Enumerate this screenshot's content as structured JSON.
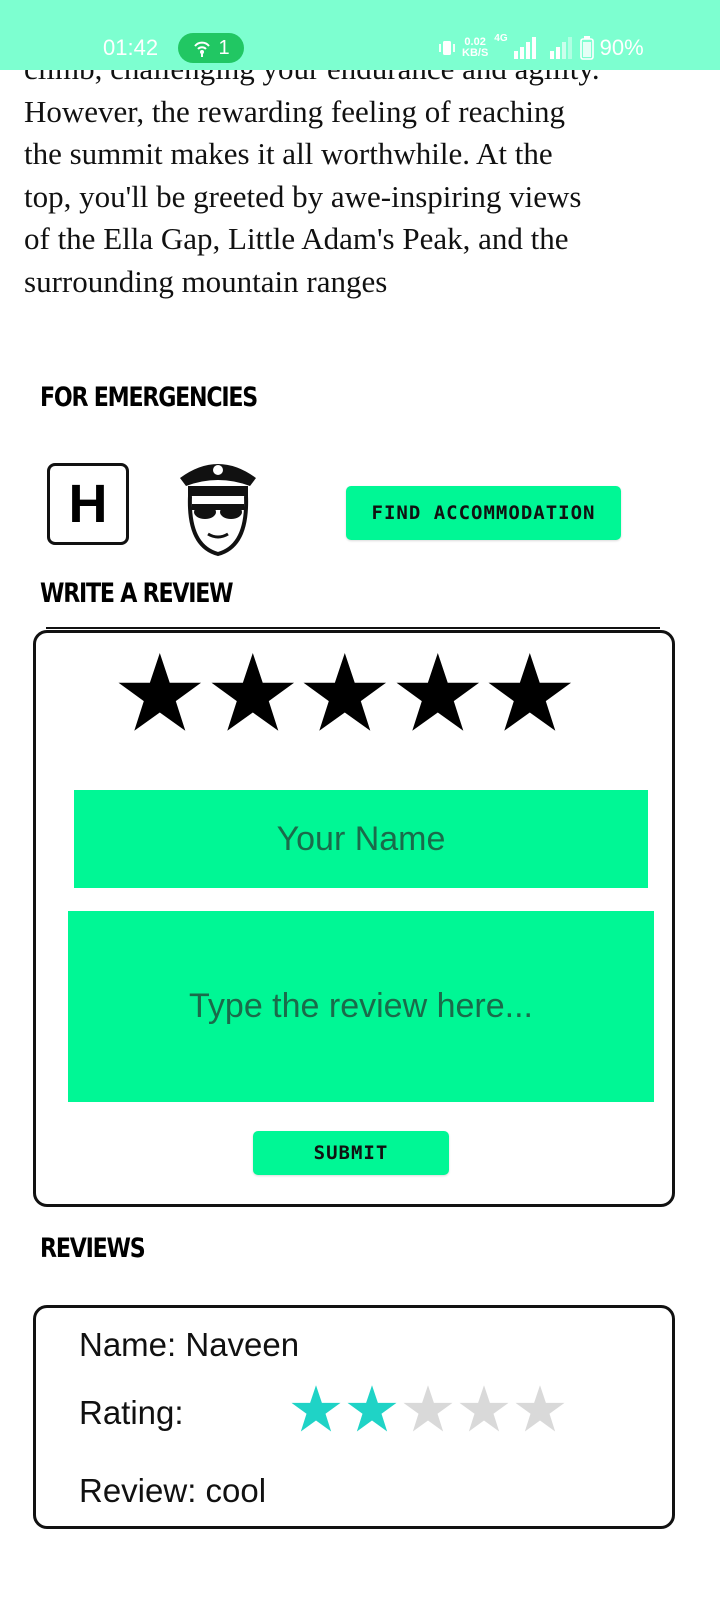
{
  "status_bar": {
    "time": "01:42",
    "hotspot_count": "1",
    "net_speed_value": "0.02",
    "net_speed_unit": "KB/S",
    "network_type": "4G",
    "battery": "90%",
    "background_color": "#7dffd0"
  },
  "description": {
    "lines": [
      "climb, challenging your endurance and agility.",
      "However, the rewarding feeling of reaching",
      "the summit makes it all worthwhile. At the",
      "top, you'll be greeted by awe-inspiring views",
      "of the Ella Gap, Little Adam's Peak, and the",
      "surrounding mountain ranges"
    ]
  },
  "emergencies": {
    "heading": "FOR EMERGENCIES",
    "hospital_icon_letter": "H",
    "find_accommodation_label": "FIND ACCOMMODATION"
  },
  "write_review": {
    "heading": "WRITE A REVIEW",
    "rating_stars": 5,
    "name_placeholder": "Your Name",
    "review_placeholder": "Type the review here...",
    "submit_label": "SUBMIT"
  },
  "reviews": {
    "heading": "REVIEWS",
    "items": [
      {
        "name_text": "Name: Naveen",
        "rating_label": "Rating:",
        "rating": 2,
        "rating_max": 5,
        "review_text": "Review: cool"
      }
    ]
  },
  "colors": {
    "accent": "#00f795",
    "star_filled": "#1fd3c6",
    "star_empty": "#d9d9d9"
  },
  "icons": [
    "hotspot-icon",
    "vibrate-icon",
    "signal-icon",
    "battery-icon",
    "hospital-icon",
    "police-icon",
    "star-icon"
  ]
}
